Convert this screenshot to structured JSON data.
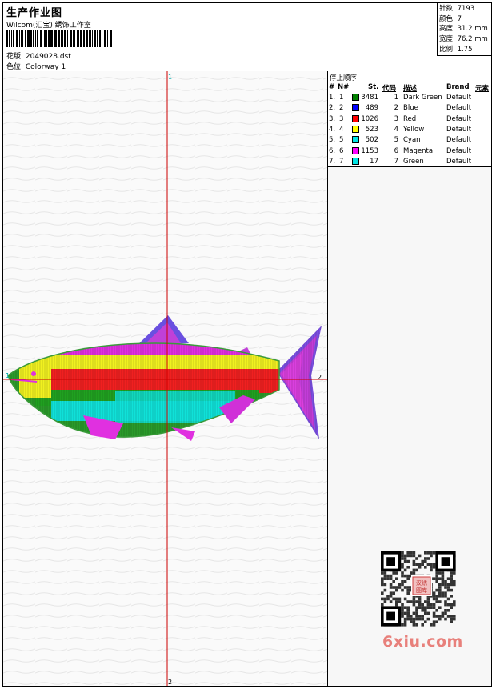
{
  "header": {
    "title": "生产作业图",
    "studio": "Wilcom(汇宝) 绣饰工作室",
    "filename": "花版: 2049028.dst",
    "colorway": "色位: Colorway 1"
  },
  "stats": {
    "stitches": "针数: 7193",
    "colors": "颜色: 7",
    "height": "高度: 31.2 mm",
    "width": "宽度: 76.2 mm",
    "scale": "比例: 1.75"
  },
  "stop_sequence": {
    "title": "停止顺序:",
    "headers": {
      "num": "#",
      "no": "N#",
      "st": "St.",
      "code": "代码",
      "desc": "描述",
      "brand": "Brand",
      "element": "元素"
    },
    "rows": [
      {
        "num": "1.",
        "no": "1",
        "color": "#008000",
        "st": "3481",
        "code": "1",
        "desc": "Dark Green",
        "brand": "Default"
      },
      {
        "num": "2.",
        "no": "2",
        "color": "#0000ff",
        "st": "489",
        "code": "2",
        "desc": "Blue",
        "brand": "Default"
      },
      {
        "num": "3.",
        "no": "3",
        "color": "#ff0000",
        "st": "1026",
        "code": "3",
        "desc": "Red",
        "brand": "Default"
      },
      {
        "num": "4.",
        "no": "4",
        "color": "#ffff00",
        "st": "523",
        "code": "4",
        "desc": "Yellow",
        "brand": "Default"
      },
      {
        "num": "5.",
        "no": "5",
        "color": "#00e5e5",
        "st": "502",
        "code": "5",
        "desc": "Cyan",
        "brand": "Default"
      },
      {
        "num": "6.",
        "no": "6",
        "color": "#ff00ff",
        "st": "1153",
        "code": "6",
        "desc": "Magenta",
        "brand": "Default"
      },
      {
        "num": "7.",
        "no": "7",
        "color": "#00e5e5",
        "st": "17",
        "code": "7",
        "desc": "Green",
        "brand": "Default"
      }
    ]
  },
  "axis_labels": {
    "top": "1",
    "bottom": "2",
    "left": "1",
    "right": "2"
  },
  "watermark": {
    "site": "6xiu.com",
    "seal": "汉绣图库"
  },
  "colors": {
    "axis": "#cc0000",
    "border": "#000000"
  }
}
